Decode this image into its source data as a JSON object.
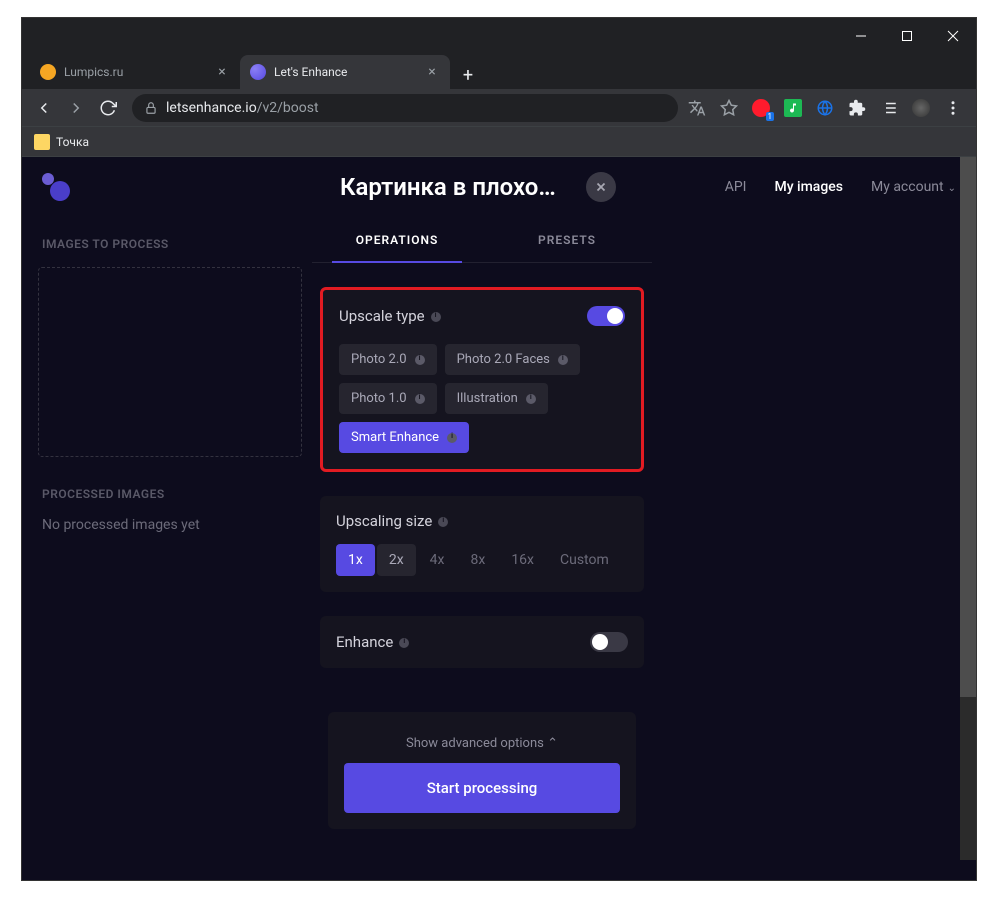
{
  "browser": {
    "tabs": [
      {
        "title": "Lumpics.ru",
        "favicon": "#f5a623"
      },
      {
        "title": "Let's Enhance",
        "favicon": "#574ae2"
      }
    ],
    "url_domain": "letsenhance.io",
    "url_path": "/v2/boost",
    "bookmark": "Точка"
  },
  "header": {
    "title": "Картинка в плохо…",
    "nav_api": "API",
    "nav_images": "My images",
    "nav_account": "My account"
  },
  "sidebar": {
    "images_label": "IMAGES TO PROCESS",
    "processed_label": "PROCESSED IMAGES",
    "no_processed": "No processed images yet"
  },
  "panel": {
    "tab_operations": "OPERATIONS",
    "tab_presets": "PRESETS",
    "upscale_type": {
      "title": "Upscale type",
      "options": [
        "Photo 2.0",
        "Photo 2.0 Faces",
        "Photo 1.0",
        "Illustration",
        "Smart Enhance"
      ]
    },
    "upscaling_size": {
      "title": "Upscaling size",
      "options": [
        "1x",
        "2x",
        "4x",
        "8x",
        "16x",
        "Custom"
      ]
    },
    "enhance_title": "Enhance",
    "advanced": "Show advanced options",
    "start": "Start processing"
  }
}
